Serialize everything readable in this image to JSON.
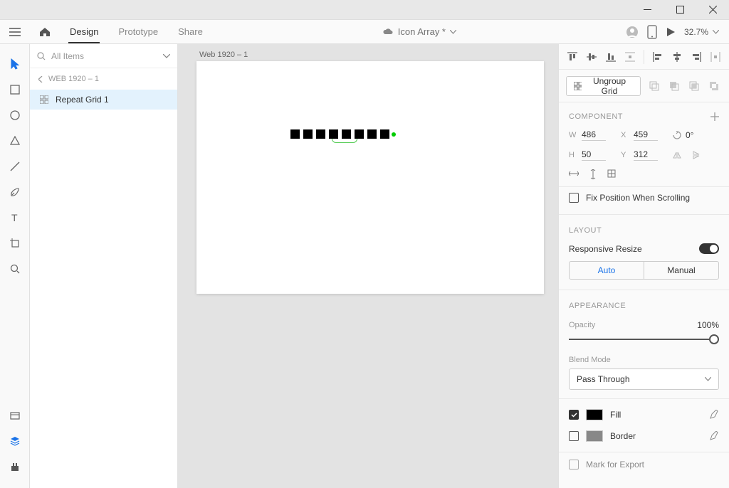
{
  "window_controls": {
    "min": "minimize",
    "max": "maximize",
    "close": "close"
  },
  "topbar": {
    "tabs": {
      "design": "Design",
      "prototype": "Prototype",
      "share": "Share"
    },
    "doc_title": "Icon Array *",
    "zoom": "32.7%"
  },
  "left_panel": {
    "search_placeholder": "All Items",
    "breadcrumb": "WEB 1920 – 1",
    "item": "Repeat Grid 1"
  },
  "canvas": {
    "artboard_label": "Web 1920 – 1"
  },
  "right_panel": {
    "ungroup": "Ungroup Grid",
    "component_head": "COMPONENT",
    "transform": {
      "w_lab": "W",
      "w": "486",
      "x_lab": "X",
      "x": "459",
      "rot": "0°",
      "h_lab": "H",
      "h": "50",
      "y_lab": "Y",
      "y": "312"
    },
    "fix_scroll": "Fix Position When Scrolling",
    "layout_head": "LAYOUT",
    "responsive": "Responsive Resize",
    "seg_auto": "Auto",
    "seg_manual": "Manual",
    "appearance_head": "APPEARANCE",
    "opacity_label": "Opacity",
    "opacity_value": "100%",
    "blend_label": "Blend Mode",
    "blend_value": "Pass Through",
    "fill_label": "Fill",
    "border_label": "Border",
    "export_label": "Mark for Export"
  },
  "chart_data": null
}
